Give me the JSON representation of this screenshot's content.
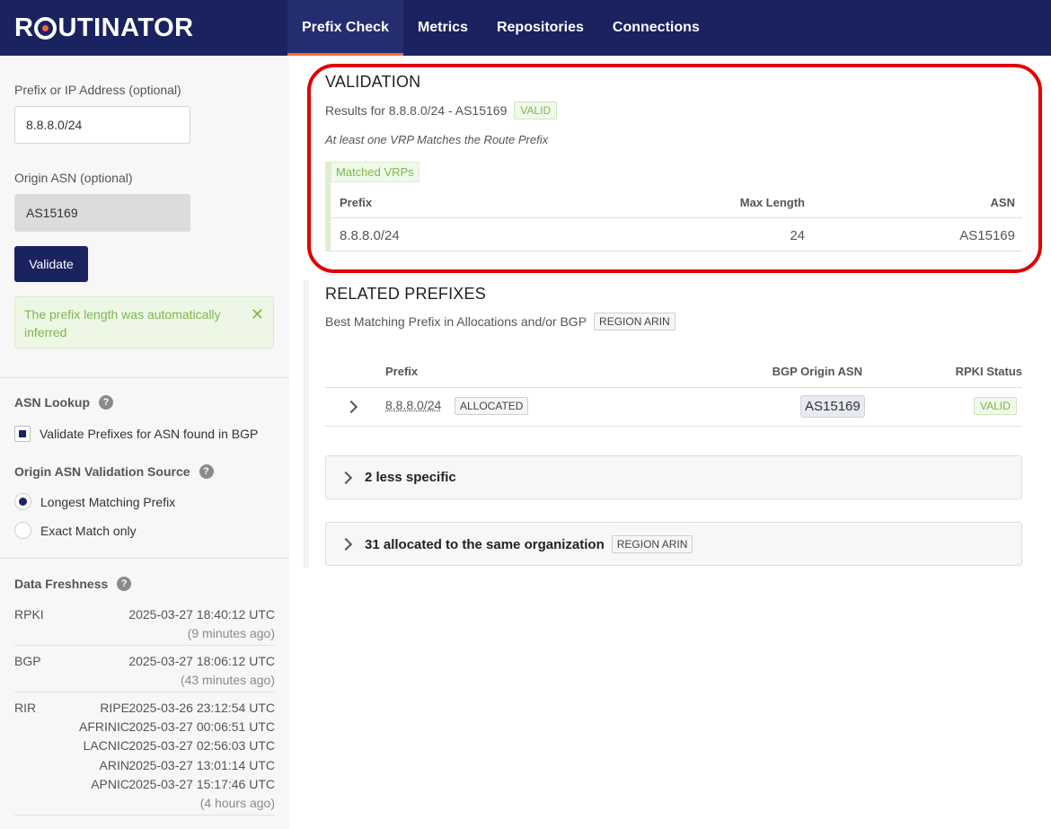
{
  "app": {
    "logo_text_pre": "R",
    "logo_text_post": "UTINATOR",
    "nav": [
      "Prefix Check",
      "Metrics",
      "Repositories",
      "Connections"
    ]
  },
  "sidebar": {
    "prefix_label": "Prefix or IP Address (optional)",
    "prefix_value": "8.8.8.0/24",
    "asn_label": "Origin ASN (optional)",
    "asn_value": "AS15169",
    "validate_label": "Validate",
    "notice": "The prefix length was automatically inferred",
    "notice_close": "✕",
    "asn_lookup_title": "ASN Lookup",
    "asn_lookup_check": "Validate Prefixes for ASN found in BGP",
    "source_title": "Origin ASN Validation Source",
    "source_options": [
      "Longest Matching Prefix",
      "Exact Match only"
    ],
    "freshness_title": "Data Freshness",
    "rpki": {
      "label": "RPKI",
      "time": "2025-03-27 18:40:12 UTC",
      "ago": "(9 minutes ago)"
    },
    "bgp": {
      "label": "BGP",
      "time": "2025-03-27 18:06:12 UTC",
      "ago": "(43 minutes ago)"
    },
    "rir": {
      "label": "RIR",
      "rows": [
        {
          "name": "RIPE",
          "time": "2025-03-26 23:12:54 UTC"
        },
        {
          "name": "AFRINIC",
          "time": "2025-03-27 00:06:51 UTC"
        },
        {
          "name": "LACNIC",
          "time": "2025-03-27 02:56:03 UTC"
        },
        {
          "name": "ARIN",
          "time": "2025-03-27 13:01:14 UTC"
        },
        {
          "name": "APNIC",
          "time": "2025-03-27 15:17:46 UTC"
        }
      ],
      "ago": "(4 hours ago)"
    }
  },
  "validation": {
    "title": "VALIDATION",
    "results": "Results for 8.8.8.0/24 - AS15169",
    "status": "VALID",
    "reason": "At least one VRP Matches the Route Prefix",
    "matched_tag": "Matched VRPs",
    "headers": [
      "Prefix",
      "Max Length",
      "ASN"
    ],
    "row": {
      "prefix": "8.8.8.0/24",
      "max_length": "24",
      "asn": "AS15169"
    }
  },
  "related": {
    "title": "RELATED PREFIXES",
    "subtitle": "Best Matching Prefix in Allocations and/or BGP",
    "region": "REGION ARIN",
    "headers": [
      "Prefix",
      "BGP Origin ASN",
      "RPKI Status"
    ],
    "row": {
      "prefix": "8.8.8.0/24",
      "badge": "ALLOCATED",
      "asn": "AS15169",
      "status": "VALID"
    },
    "less_specific": "2 less specific",
    "same_org": "31 allocated to the same organization",
    "same_org_region": "REGION ARIN"
  },
  "colors": {
    "navy": "#1a2260",
    "accent": "#f26b3a",
    "valid_green": "#7bb84d",
    "highlight": "#e00000"
  }
}
